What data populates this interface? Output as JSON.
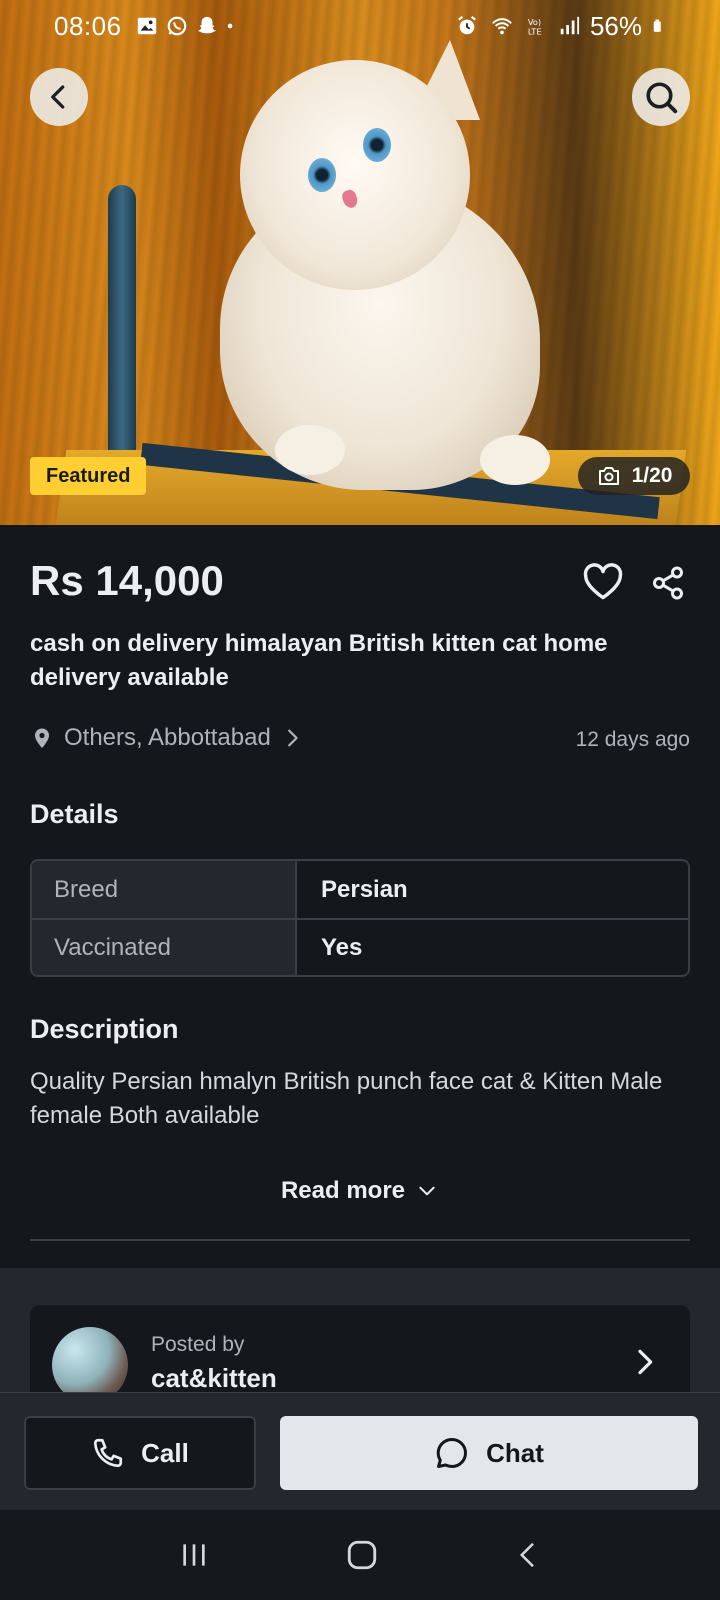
{
  "status_bar": {
    "time": "08:06",
    "battery": "56%",
    "icons_left": [
      "gallery-icon",
      "whatsapp-icon",
      "snapchat-icon",
      "dot-icon"
    ],
    "icons_right": [
      "alarm-icon",
      "wifi-icon",
      "volte-icon",
      "signal-icon",
      "battery-icon"
    ]
  },
  "hero": {
    "featured_label": "Featured",
    "photo_counter": "1/20"
  },
  "listing": {
    "price": "Rs 14,000",
    "title": "cash on delivery himalayan British kitten cat home delivery available",
    "location": "Others, Abbottabad",
    "posted_ago": "12 days ago"
  },
  "details": {
    "heading": "Details",
    "rows": [
      {
        "key": "Breed",
        "value": "Persian"
      },
      {
        "key": "Vaccinated",
        "value": "Yes"
      }
    ]
  },
  "description": {
    "heading": "Description",
    "text": "Quality Persian hmalyn British punch face cat & Kitten Male female Both available",
    "read_more": "Read more"
  },
  "poster": {
    "posted_by_label": "Posted by",
    "name": "cat&kitten"
  },
  "actions": {
    "call_label": "Call",
    "chat_label": "Chat"
  },
  "colors": {
    "background": "#14171c",
    "featured_badge": "#ffce32",
    "chat_button": "#e3e6ea"
  }
}
